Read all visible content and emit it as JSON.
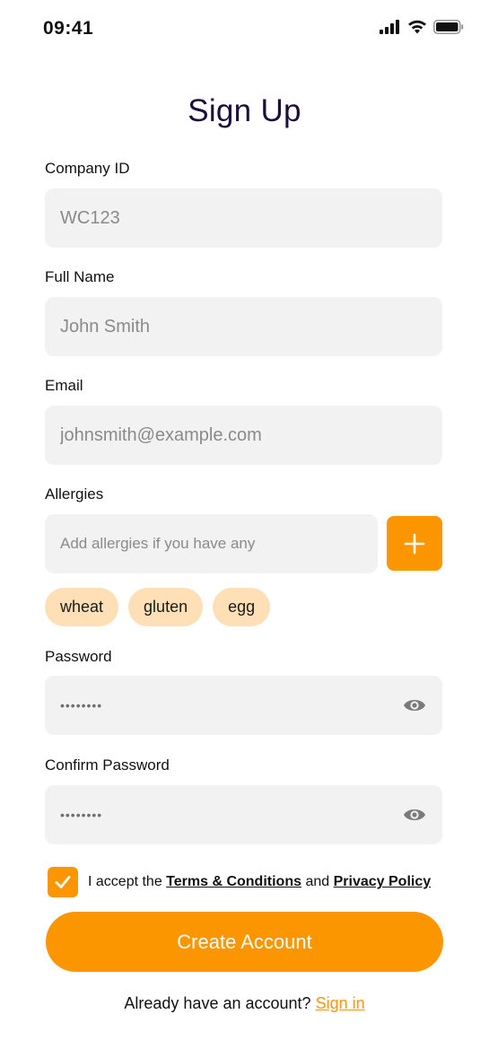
{
  "status_bar": {
    "time": "09:41"
  },
  "title": "Sign Up",
  "form": {
    "company_id": {
      "label": "Company ID",
      "placeholder": "WC123"
    },
    "full_name": {
      "label": "Full Name",
      "placeholder": "John Smith"
    },
    "email": {
      "label": "Email",
      "placeholder": "johnsmith@example.com"
    },
    "allergies": {
      "label": "Allergies",
      "placeholder": "Add allergies if you have any",
      "chips": [
        "wheat",
        "gluten",
        "egg"
      ]
    },
    "password": {
      "label": "Password",
      "value": "••••••••"
    },
    "confirm_password": {
      "label": "Confirm Password",
      "value": "••••••••"
    }
  },
  "terms": {
    "prefix": "I accept the",
    "terms_link": "Terms & Conditions",
    "and": "and",
    "privacy_link": "Privacy Policy",
    "checked": true
  },
  "create_button": "Create Account",
  "signin": {
    "prompt": "Already have an account?",
    "link": "Sign in"
  },
  "colors": {
    "accent": "#fb9600",
    "chip_bg": "#ffe0b6",
    "field_bg": "#f2f2f2",
    "title": "#1c0f3a"
  }
}
